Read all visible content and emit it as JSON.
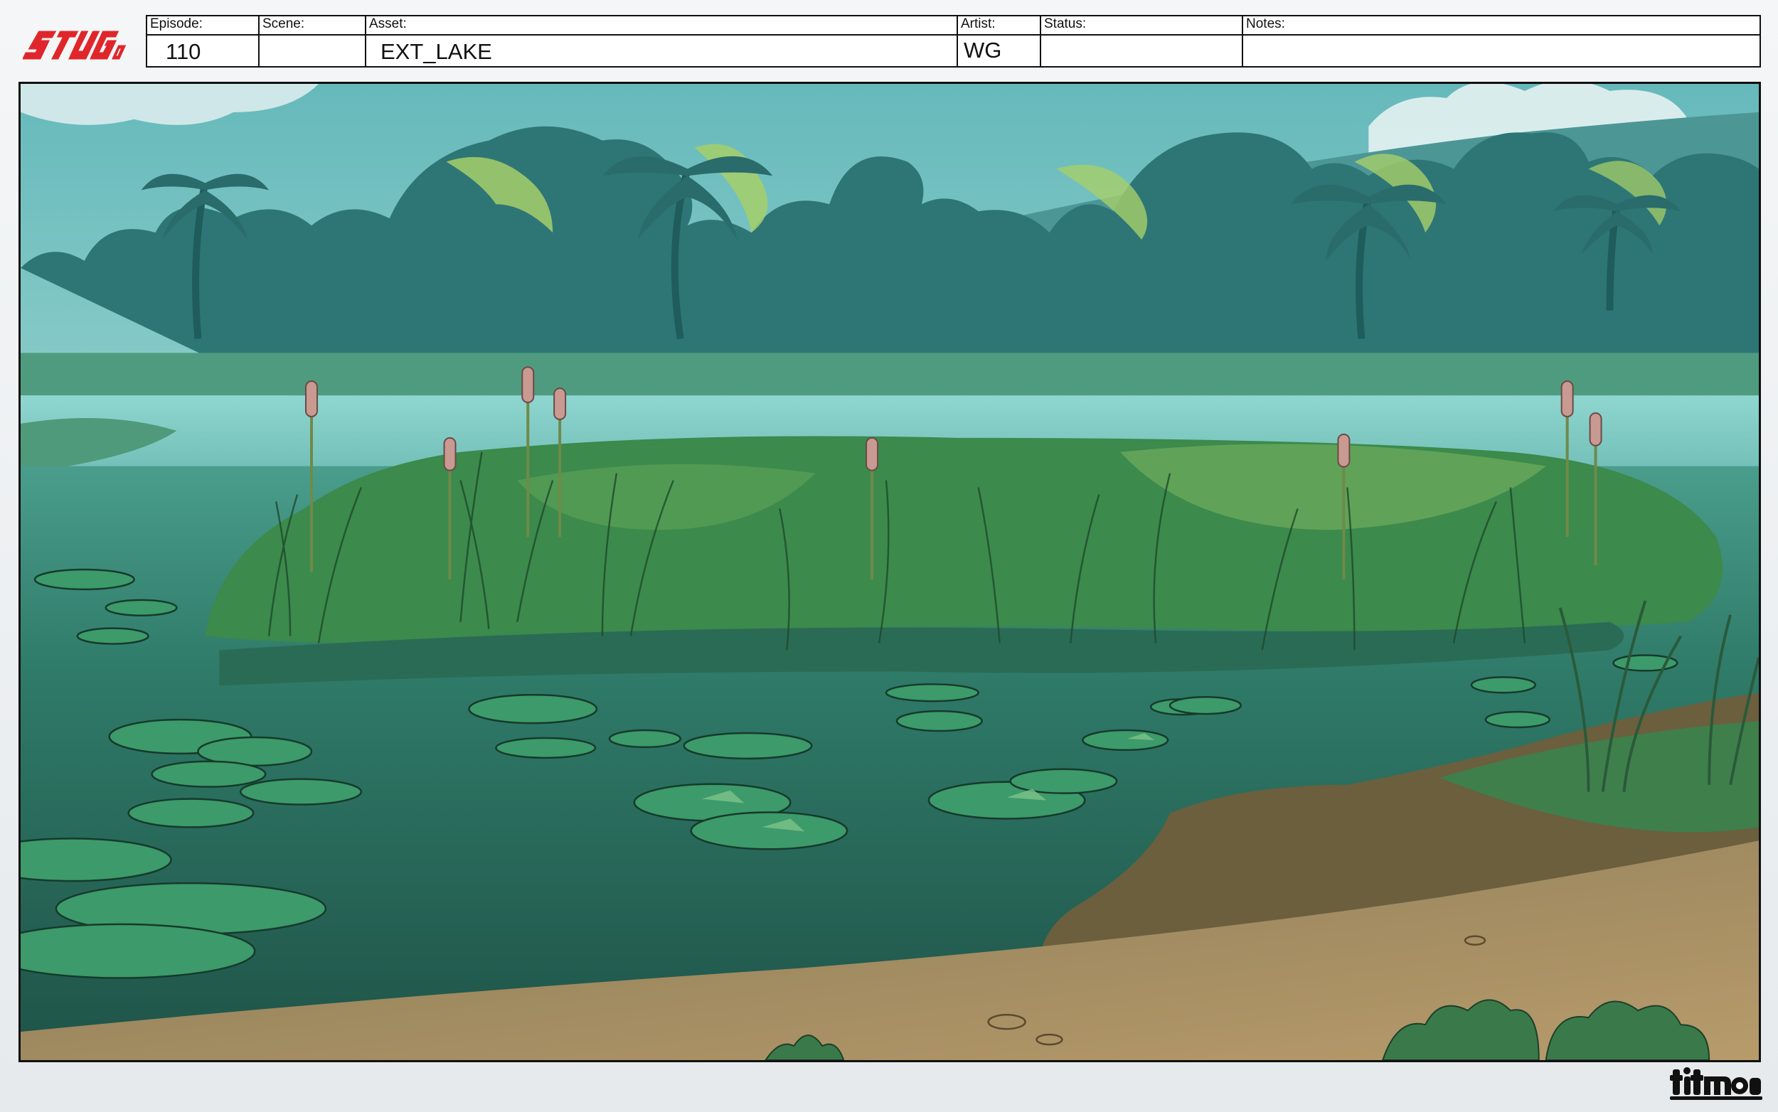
{
  "brand": {
    "show_logo": "STUGo",
    "studio_logo": "titmouse",
    "accent": "#e0262a"
  },
  "slate": {
    "episode": {
      "label": "Episode:",
      "value": "110"
    },
    "scene": {
      "label": "Scene:",
      "value": ""
    },
    "asset": {
      "label": "Asset:",
      "value": "EXT_LAKE"
    },
    "artist": {
      "label": "Artist:",
      "value": "WG"
    },
    "status": {
      "label": "Status:",
      "value": ""
    },
    "notes": {
      "label": "Notes:",
      "value": ""
    }
  },
  "artwork": {
    "subject": "lake-background-painting",
    "palette": {
      "sky": "#5fb3b6",
      "water": "#2f7466",
      "reeds": "#3f8a48",
      "shore": "#a98e63"
    }
  }
}
